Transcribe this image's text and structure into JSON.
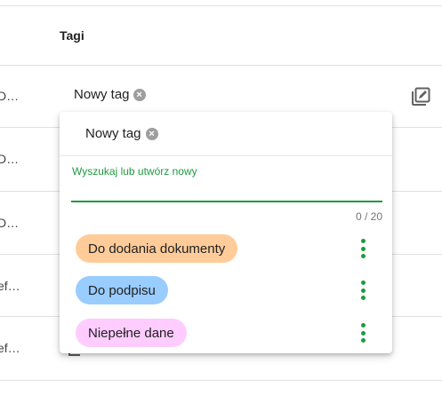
{
  "table": {
    "column_header": "Tagi",
    "row_truncations": [
      "D…",
      "D…",
      "D…",
      "ef…",
      "ef…"
    ],
    "current_tag": {
      "label": "Nowy tag",
      "remove_glyph": "×"
    }
  },
  "tag_dropdown": {
    "selected_tag": {
      "label": "Nowy tag",
      "remove_glyph": "×"
    },
    "search_label": "Wyszukaj lub utwórz nowy",
    "search_value": "",
    "counter": "0 / 20",
    "options": [
      {
        "label": "Do dodania dokumenty",
        "color": "#ffcc99"
      },
      {
        "label": "Do podpisu",
        "color": "#99ccff"
      },
      {
        "label": "Niepełne dane",
        "color": "#ffccff"
      }
    ]
  },
  "colors": {
    "accent": "#1e9a3f",
    "divider": "#e0e0e0"
  },
  "icons": [
    "remove-tag-icon",
    "edit-icon",
    "more-vert-icon",
    "copy-icon"
  ]
}
